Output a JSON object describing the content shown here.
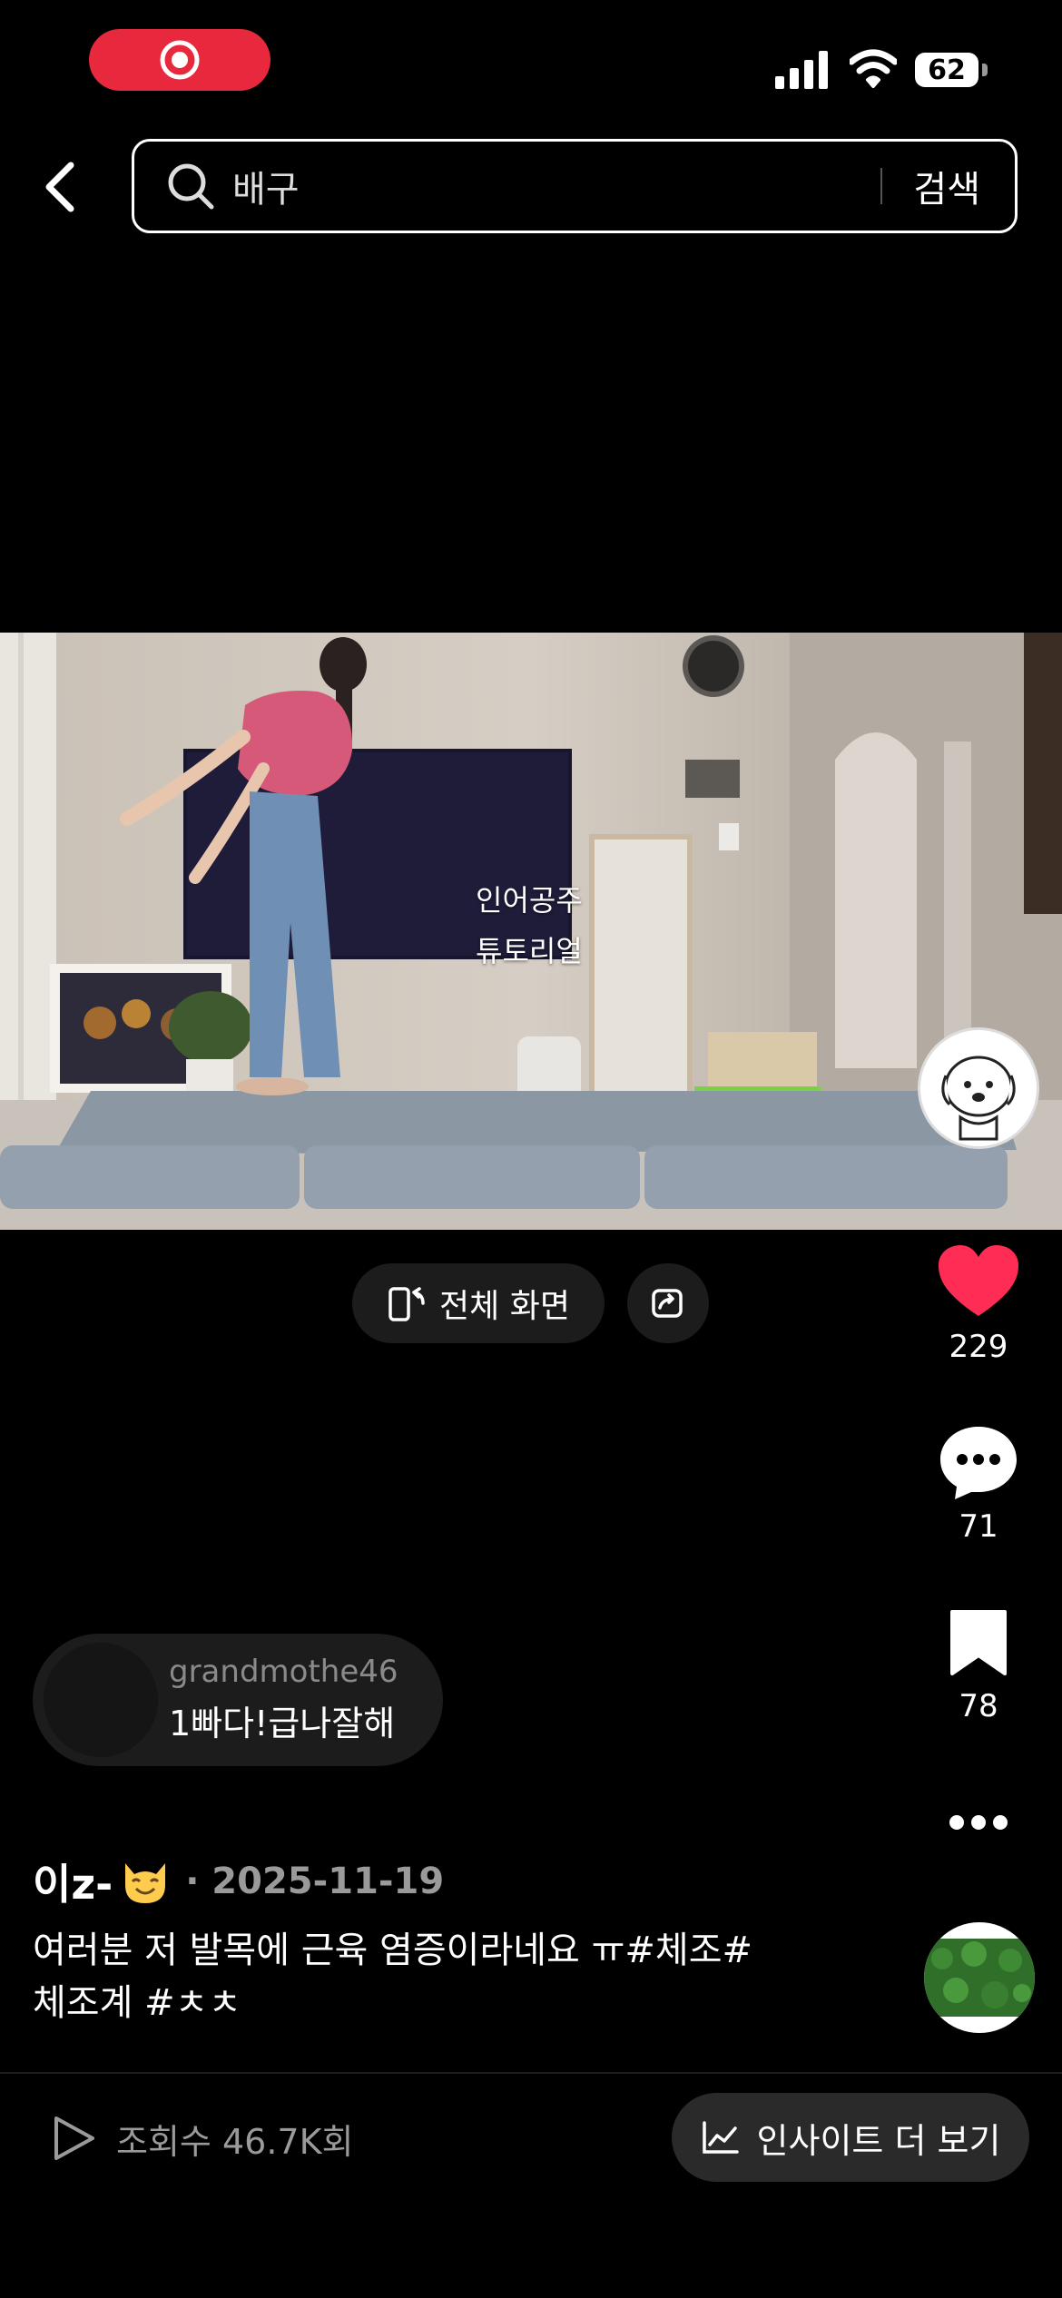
{
  "status": {
    "battery": "62",
    "icons": [
      "record-icon",
      "signal-icon",
      "wifi-icon",
      "battery-icon"
    ]
  },
  "search": {
    "query": "배구",
    "button_label": "검색"
  },
  "video": {
    "caption_line1": "인어공주",
    "caption_line2": "튜토리얼"
  },
  "controls": {
    "fullscreen_label": "전체 화면"
  },
  "rail": {
    "likes": "229",
    "comments": "71",
    "bookmarks": "78"
  },
  "comment": {
    "username": "grandmothe46",
    "text": "1빠다!급나잘해"
  },
  "post": {
    "author": "이z-",
    "date": "· 2025-11-19",
    "description_line1": "여러분 저 발목에 근육 염증이라네요 ㅠ#체조#",
    "description_line2": "체조계 #ㅊㅊ"
  },
  "footer": {
    "views": "조회수 46.7K회",
    "insight_label": "인사이트 더 보기"
  },
  "colors": {
    "accent_red": "#e8283c",
    "like_red": "#ff2d55",
    "background": "#000000"
  }
}
